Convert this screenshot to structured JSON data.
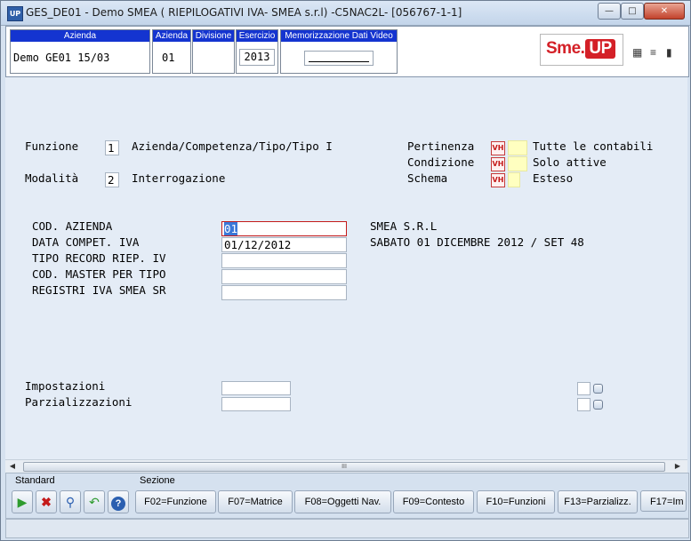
{
  "window": {
    "app_icon": "UP",
    "title": "GES_DE01 - Demo SMEA ( RIEPILOGATIVI IVA- SMEA s.r.l) -C5NAC2L- [056767-1-1]",
    "controls": [
      "minimize-icon",
      "maximize-icon",
      "close-icon"
    ]
  },
  "header": {
    "azienda_label": "Azienda",
    "azienda_value": "Demo GE01 15/03",
    "azienda_code_label": "Azienda",
    "azienda_code_value": "01",
    "divisione_label": "Divisione",
    "esercizio_label": "Esercizio",
    "esercizio_value": "2013",
    "memorizzazione_label": "Memorizzazione Dati Video",
    "logo_text": "Sme.",
    "logo_up": "UP",
    "icons": [
      "calendar-icon",
      "list-icon",
      "book-icon"
    ]
  },
  "form": {
    "funzione_label": "Funzione",
    "funzione_value": "1",
    "funzione_desc": "Azienda/Competenza/Tipo/Tipo I",
    "modalita_label": "Modalità",
    "modalita_value": "2",
    "modalita_desc": "Interrogazione",
    "pertinenza_label": "Pertinenza",
    "pertinenza_desc": "Tutte le contabili",
    "condizione_label": "Condizione",
    "condizione_desc": "Solo attive",
    "schema_label": "Schema",
    "schema_desc": "Esteso",
    "vh_label": "VH",
    "fields": [
      {
        "label": "COD. AZIENDA",
        "value": "01",
        "desc": "SMEA S.R.L"
      },
      {
        "label": "DATA COMPET. IVA",
        "value": "01/12/2012",
        "desc": "SABATO 01 DICEMBRE 2012 / SET 48"
      },
      {
        "label": "TIPO RECORD RIEP. IV",
        "value": "",
        "desc": ""
      },
      {
        "label": "COD. MASTER PER TIPO",
        "value": "",
        "desc": ""
      },
      {
        "label": "REGISTRI IVA SMEA SR",
        "value": "",
        "desc": ""
      }
    ],
    "impostazioni_label": "Impostazioni",
    "parzializzazioni_label": "Parzializzazioni"
  },
  "scrollbar": {
    "grip": "III"
  },
  "toolbar": {
    "standard_label": "Standard",
    "sezione_label": "Sezione",
    "standard_buttons": [
      "play-icon",
      "delete-icon",
      "search-icon",
      "undo-icon",
      "help-icon"
    ],
    "function_buttons": [
      "F02=Funzione",
      "F07=Matrice",
      "F08=Oggetti Nav.",
      "F09=Contesto",
      "F10=Funzioni",
      "F13=Parzializz.",
      "F17=Im"
    ]
  },
  "colors": {
    "header_label_bg": "#1434d0",
    "selection_border": "#c41a1a",
    "logo_red": "#d42027",
    "yellow_field": "#ffffc0"
  }
}
